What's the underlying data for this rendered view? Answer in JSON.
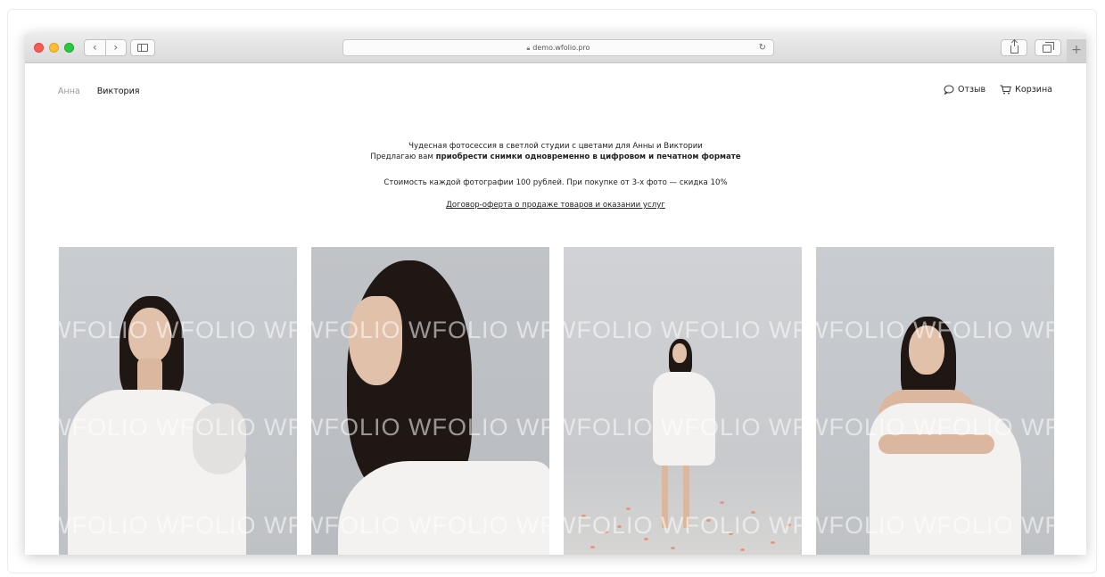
{
  "browser": {
    "url": "demo.wfolio.pro",
    "nav_back": "‹",
    "nav_forward": "›",
    "reload_icon": "reload-icon",
    "lock_icon": "lock-icon",
    "new_tab": "+"
  },
  "header": {
    "nav": [
      {
        "label": "Анна",
        "active": false
      },
      {
        "label": "Виктория",
        "active": true
      }
    ],
    "feedback_label": "Отзыв",
    "feedback_icon": "speech-bubble-icon",
    "cart_label": "Корзина",
    "cart_icon": "cart-icon"
  },
  "intro": {
    "line1": "Чудесная фотосессия в светлой студии с цветами для Анны и Виктории",
    "line2_prefix": "Предлагаю вам ",
    "line2_bold": "приобрести снимки одновременно в цифровом и печатном формате",
    "price": "Стоимость каждой фотографии 100 рублей. При покупке от 3-х фото — скидка 10%",
    "contract_link": "Договор-оферта о продаже товаров и оказании услуг"
  },
  "gallery": {
    "watermark": "WFOLIO WFOLIO WFOLIO",
    "photos": [
      {
        "subject": "woman-in-white-dress-portrait"
      },
      {
        "subject": "woman-profile-closeup"
      },
      {
        "subject": "woman-standing-with-petals"
      },
      {
        "subject": "woman-arms-crossed-portrait"
      }
    ]
  },
  "colors": {
    "traffic_red": "#fd5a55",
    "traffic_yellow": "#febe2e",
    "traffic_green": "#29c940",
    "photo_background": "#c6c9cd",
    "petal": "#e9937a"
  }
}
